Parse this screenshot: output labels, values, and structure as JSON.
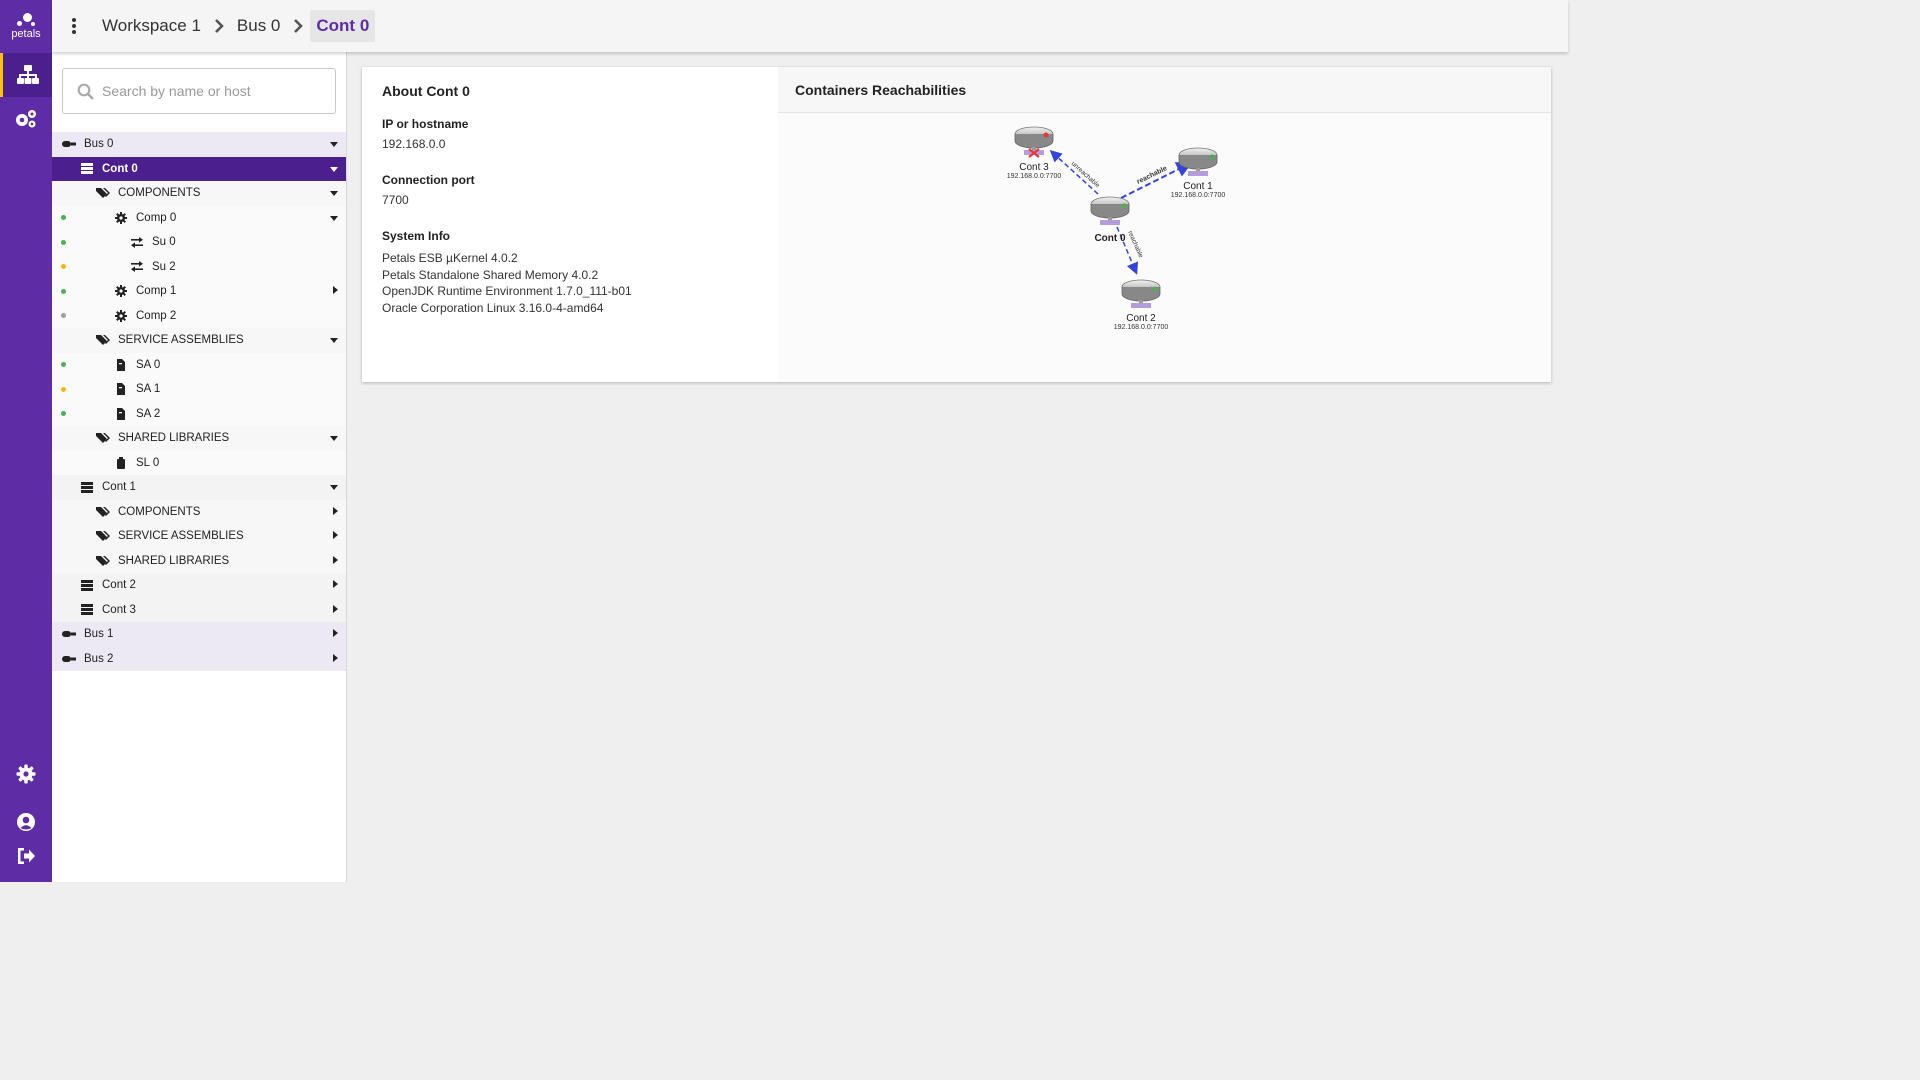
{
  "app": {
    "logo_text": "petals"
  },
  "breadcrumb": [
    "Workspace 1",
    "Bus 0",
    "Cont 0"
  ],
  "search": {
    "placeholder": "Search by name or host",
    "value": ""
  },
  "tree": [
    {
      "label": "Bus 0",
      "kind": "bus",
      "caret": "down"
    },
    {
      "label": "Cont 0",
      "kind": "cont",
      "caret": "down",
      "selected": true
    },
    {
      "label": "COMPONENTS",
      "kind": "cat",
      "caret": "down"
    },
    {
      "label": "Comp 0",
      "kind": "comp",
      "caret": "down",
      "status": "green"
    },
    {
      "label": "Su 0",
      "kind": "su",
      "status": "green"
    },
    {
      "label": "Su 2",
      "kind": "su",
      "status": "yellow"
    },
    {
      "label": "Comp 1",
      "kind": "comp",
      "caret": "right",
      "status": "green"
    },
    {
      "label": "Comp 2",
      "kind": "comp",
      "status": "grey"
    },
    {
      "label": "SERVICE ASSEMBLIES",
      "kind": "cat",
      "caret": "down"
    },
    {
      "label": "SA 0",
      "kind": "sa",
      "status": "green"
    },
    {
      "label": "SA 1",
      "kind": "sa",
      "status": "yellow"
    },
    {
      "label": "SA 2",
      "kind": "sa",
      "status": "green"
    },
    {
      "label": "SHARED LIBRARIES",
      "kind": "cat",
      "caret": "down"
    },
    {
      "label": "SL 0",
      "kind": "sl"
    },
    {
      "label": "Cont 1",
      "kind": "cont",
      "caret": "down"
    },
    {
      "label": "COMPONENTS",
      "kind": "cat2",
      "caret": "right"
    },
    {
      "label": "SERVICE ASSEMBLIES",
      "kind": "cat2",
      "caret": "right"
    },
    {
      "label": "SHARED LIBRARIES",
      "kind": "cat2",
      "caret": "right"
    },
    {
      "label": "Cont 2",
      "kind": "cont",
      "caret": "right"
    },
    {
      "label": "Cont 3",
      "kind": "cont",
      "caret": "right"
    },
    {
      "label": "Bus 1",
      "kind": "bus",
      "caret": "right"
    },
    {
      "label": "Bus 2",
      "kind": "bus",
      "caret": "right"
    }
  ],
  "about": {
    "title": "About Cont 0",
    "ip_label": "IP or hostname",
    "ip_value": "192.168.0.0",
    "port_label": "Connection port",
    "port_value": "7700",
    "sysinfo_label": "System Info",
    "sysinfo": [
      "Petals ESB µKernel 4.0.2",
      "Petals Standalone Shared Memory 4.0.2",
      "OpenJDK Runtime Environment 1.7.0_111-b01",
      "Oracle Corporation Linux 3.16.0-4-amd64"
    ]
  },
  "reachability": {
    "title": "Containers Reachabilities",
    "nodes": [
      {
        "name": "Cont 0",
        "address": ""
      },
      {
        "name": "Cont 1",
        "address": "192.168.0.0:7700"
      },
      {
        "name": "Cont 2",
        "address": "192.168.0.0:7700"
      },
      {
        "name": "Cont 3",
        "address": "192.168.0.0:7700"
      }
    ],
    "links": [
      "reachable",
      "reachable",
      "unreachable"
    ]
  },
  "colors": {
    "brand": "#5e2ca5",
    "accent": "#ffc107",
    "green": "#4caf50",
    "yellow": "#f5b800",
    "grey": "#9e9e9e"
  }
}
